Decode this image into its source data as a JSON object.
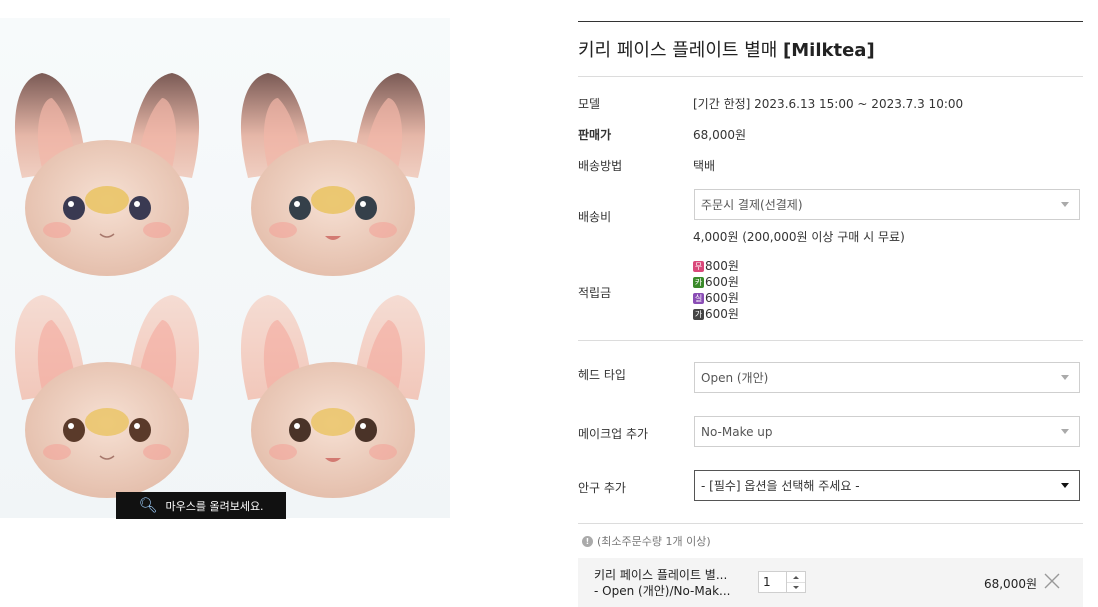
{
  "gallery": {
    "zoom_hint": "마우스를 올려보세요."
  },
  "product": {
    "title_main": "키리 페이스 플레이트 별매 ",
    "title_bold": "[Milktea]",
    "fields": {
      "model_label": "모델",
      "model_value": "[기간 한정] 2023.6.13 15:00 ~ 2023.7.3 10:00",
      "price_label": "판매가",
      "price_value": "68,000원",
      "shipping_method_label": "배송방법",
      "shipping_method_value": "택배",
      "shipping_fee_label": "배송비",
      "shipping_fee_select": "주문시 결제(선결제)",
      "shipping_fee_note": "4,000원 (200,000원 이상 구매 시 무료)",
      "points_label": "적립금",
      "points": [
        {
          "badge": "무",
          "color": "#d9487a",
          "value": "800원"
        },
        {
          "badge": "카",
          "color": "#3a8a2a",
          "value": "600원"
        },
        {
          "badge": "실",
          "color": "#8a4db5",
          "value": "600원"
        },
        {
          "badge": "가",
          "color": "#444444",
          "value": "600원"
        }
      ]
    },
    "options": {
      "head_type_label": "헤드 타입",
      "head_type_value": "Open (개안)",
      "makeup_label": "메이크업 추가",
      "makeup_value": "No-Make up",
      "eye_label": "안구 추가",
      "eye_value": "- [필수] 옵션을 선택해 주세요 -"
    },
    "min_order_note": "(최소주문수량 1개 이상)",
    "order_item": {
      "name": "키리 페이스 플레이트 별...",
      "option": "- Open (개안)/No-Mak...",
      "quantity": "1",
      "price": "68,000원"
    }
  }
}
